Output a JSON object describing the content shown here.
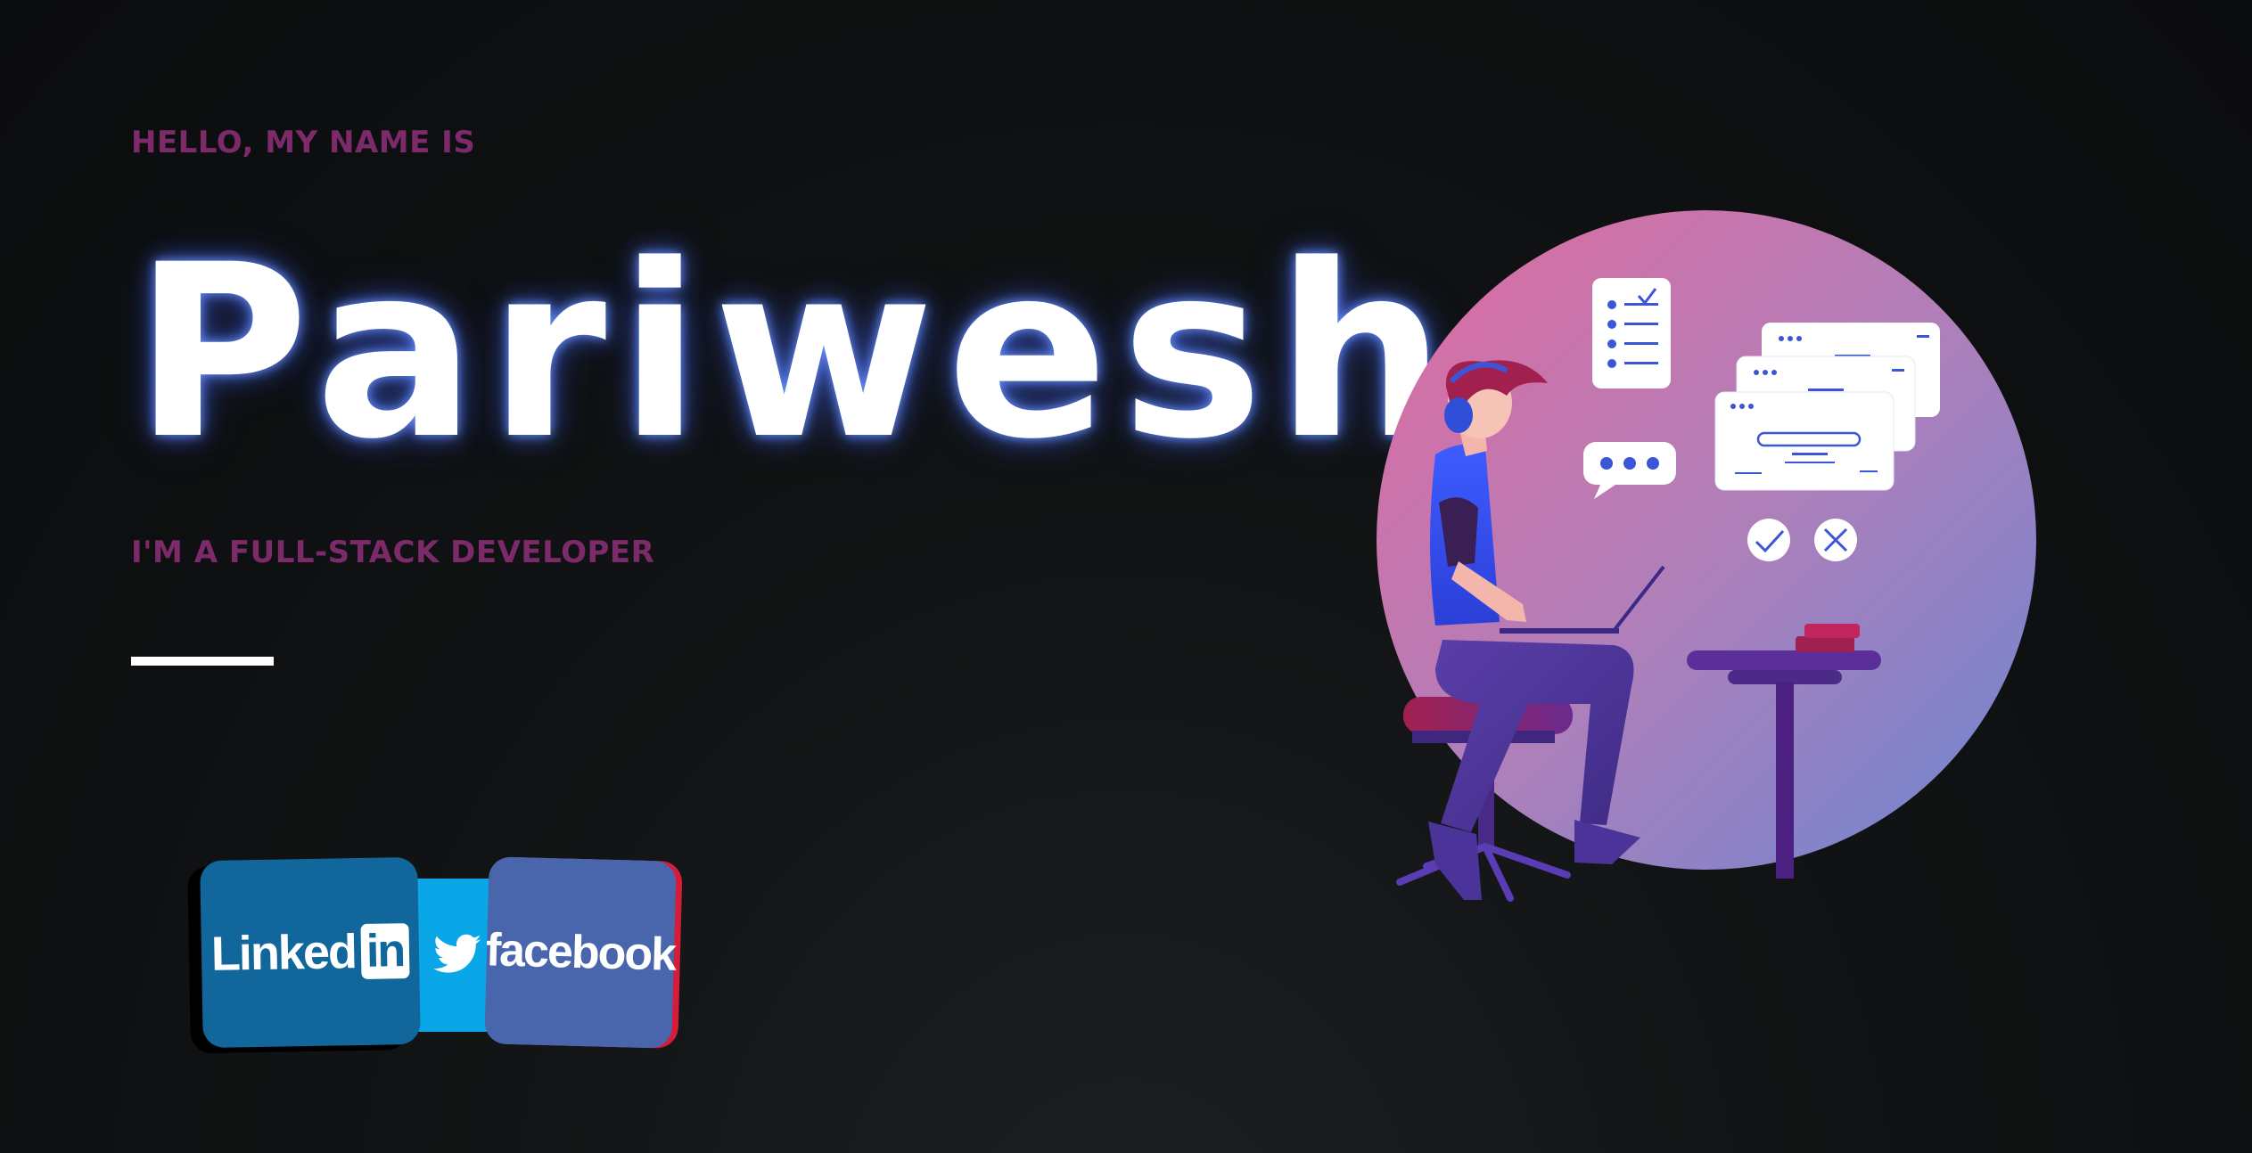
{
  "hero": {
    "greeting": "HELLO, MY NAME IS",
    "name": "Pariwesh",
    "role": "I'M A FULL-STACK DEVELOPER"
  },
  "social": {
    "linkedin_text": "Linked",
    "linkedin_box": "in",
    "facebook_text": "facebook",
    "twitter_icon": "twitter-bird-icon"
  },
  "colors": {
    "accent": "#7d2a6b",
    "name_glow": "#5a7dff",
    "linkedin": "#11679b",
    "twitter": "#09a6e8",
    "facebook": "#4966ad"
  }
}
